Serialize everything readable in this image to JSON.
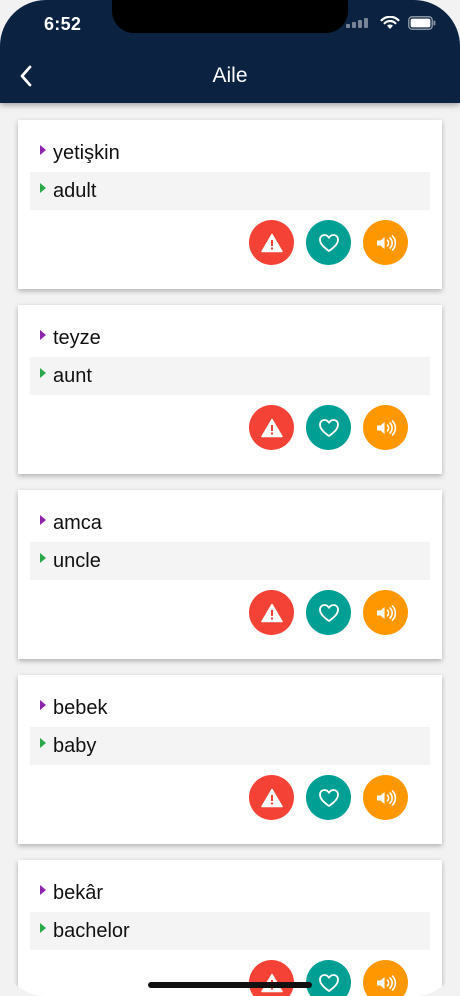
{
  "status": {
    "time": "6:52"
  },
  "header": {
    "title": "Aile"
  },
  "colors": {
    "appbar": "#0b2240",
    "source_marker": "#8e24aa",
    "target_marker": "#2aa84a",
    "report_button": "#f44336",
    "favorite_button": "#009f93",
    "sound_button": "#ff9800"
  },
  "icons": {
    "back": "chevron-left-icon",
    "report": "warning-icon",
    "favorite": "heart-outline-icon",
    "sound": "speaker-icon"
  },
  "cards": [
    {
      "source": "yetişkin",
      "target": "adult"
    },
    {
      "source": "teyze",
      "target": "aunt"
    },
    {
      "source": "amca",
      "target": "uncle"
    },
    {
      "source": "bebek",
      "target": "baby"
    },
    {
      "source": "bekâr",
      "target": "bachelor"
    }
  ]
}
